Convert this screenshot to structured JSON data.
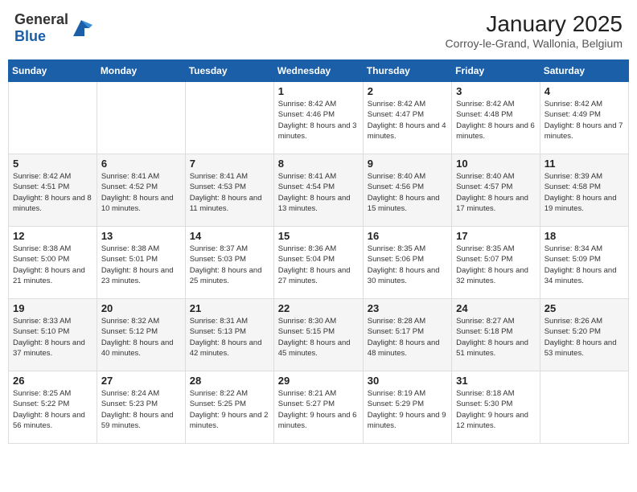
{
  "header": {
    "logo_general": "General",
    "logo_blue": "Blue",
    "month_title": "January 2025",
    "subtitle": "Corroy-le-Grand, Wallonia, Belgium"
  },
  "days_of_week": [
    "Sunday",
    "Monday",
    "Tuesday",
    "Wednesday",
    "Thursday",
    "Friday",
    "Saturday"
  ],
  "weeks": [
    [
      {
        "day": "",
        "info": ""
      },
      {
        "day": "",
        "info": ""
      },
      {
        "day": "",
        "info": ""
      },
      {
        "day": "1",
        "info": "Sunrise: 8:42 AM\nSunset: 4:46 PM\nDaylight: 8 hours and 3 minutes."
      },
      {
        "day": "2",
        "info": "Sunrise: 8:42 AM\nSunset: 4:47 PM\nDaylight: 8 hours and 4 minutes."
      },
      {
        "day": "3",
        "info": "Sunrise: 8:42 AM\nSunset: 4:48 PM\nDaylight: 8 hours and 6 minutes."
      },
      {
        "day": "4",
        "info": "Sunrise: 8:42 AM\nSunset: 4:49 PM\nDaylight: 8 hours and 7 minutes."
      }
    ],
    [
      {
        "day": "5",
        "info": "Sunrise: 8:42 AM\nSunset: 4:51 PM\nDaylight: 8 hours and 8 minutes."
      },
      {
        "day": "6",
        "info": "Sunrise: 8:41 AM\nSunset: 4:52 PM\nDaylight: 8 hours and 10 minutes."
      },
      {
        "day": "7",
        "info": "Sunrise: 8:41 AM\nSunset: 4:53 PM\nDaylight: 8 hours and 11 minutes."
      },
      {
        "day": "8",
        "info": "Sunrise: 8:41 AM\nSunset: 4:54 PM\nDaylight: 8 hours and 13 minutes."
      },
      {
        "day": "9",
        "info": "Sunrise: 8:40 AM\nSunset: 4:56 PM\nDaylight: 8 hours and 15 minutes."
      },
      {
        "day": "10",
        "info": "Sunrise: 8:40 AM\nSunset: 4:57 PM\nDaylight: 8 hours and 17 minutes."
      },
      {
        "day": "11",
        "info": "Sunrise: 8:39 AM\nSunset: 4:58 PM\nDaylight: 8 hours and 19 minutes."
      }
    ],
    [
      {
        "day": "12",
        "info": "Sunrise: 8:38 AM\nSunset: 5:00 PM\nDaylight: 8 hours and 21 minutes."
      },
      {
        "day": "13",
        "info": "Sunrise: 8:38 AM\nSunset: 5:01 PM\nDaylight: 8 hours and 23 minutes."
      },
      {
        "day": "14",
        "info": "Sunrise: 8:37 AM\nSunset: 5:03 PM\nDaylight: 8 hours and 25 minutes."
      },
      {
        "day": "15",
        "info": "Sunrise: 8:36 AM\nSunset: 5:04 PM\nDaylight: 8 hours and 27 minutes."
      },
      {
        "day": "16",
        "info": "Sunrise: 8:35 AM\nSunset: 5:06 PM\nDaylight: 8 hours and 30 minutes."
      },
      {
        "day": "17",
        "info": "Sunrise: 8:35 AM\nSunset: 5:07 PM\nDaylight: 8 hours and 32 minutes."
      },
      {
        "day": "18",
        "info": "Sunrise: 8:34 AM\nSunset: 5:09 PM\nDaylight: 8 hours and 34 minutes."
      }
    ],
    [
      {
        "day": "19",
        "info": "Sunrise: 8:33 AM\nSunset: 5:10 PM\nDaylight: 8 hours and 37 minutes."
      },
      {
        "day": "20",
        "info": "Sunrise: 8:32 AM\nSunset: 5:12 PM\nDaylight: 8 hours and 40 minutes."
      },
      {
        "day": "21",
        "info": "Sunrise: 8:31 AM\nSunset: 5:13 PM\nDaylight: 8 hours and 42 minutes."
      },
      {
        "day": "22",
        "info": "Sunrise: 8:30 AM\nSunset: 5:15 PM\nDaylight: 8 hours and 45 minutes."
      },
      {
        "day": "23",
        "info": "Sunrise: 8:28 AM\nSunset: 5:17 PM\nDaylight: 8 hours and 48 minutes."
      },
      {
        "day": "24",
        "info": "Sunrise: 8:27 AM\nSunset: 5:18 PM\nDaylight: 8 hours and 51 minutes."
      },
      {
        "day": "25",
        "info": "Sunrise: 8:26 AM\nSunset: 5:20 PM\nDaylight: 8 hours and 53 minutes."
      }
    ],
    [
      {
        "day": "26",
        "info": "Sunrise: 8:25 AM\nSunset: 5:22 PM\nDaylight: 8 hours and 56 minutes."
      },
      {
        "day": "27",
        "info": "Sunrise: 8:24 AM\nSunset: 5:23 PM\nDaylight: 8 hours and 59 minutes."
      },
      {
        "day": "28",
        "info": "Sunrise: 8:22 AM\nSunset: 5:25 PM\nDaylight: 9 hours and 2 minutes."
      },
      {
        "day": "29",
        "info": "Sunrise: 8:21 AM\nSunset: 5:27 PM\nDaylight: 9 hours and 6 minutes."
      },
      {
        "day": "30",
        "info": "Sunrise: 8:19 AM\nSunset: 5:29 PM\nDaylight: 9 hours and 9 minutes."
      },
      {
        "day": "31",
        "info": "Sunrise: 8:18 AM\nSunset: 5:30 PM\nDaylight: 9 hours and 12 minutes."
      },
      {
        "day": "",
        "info": ""
      }
    ]
  ]
}
